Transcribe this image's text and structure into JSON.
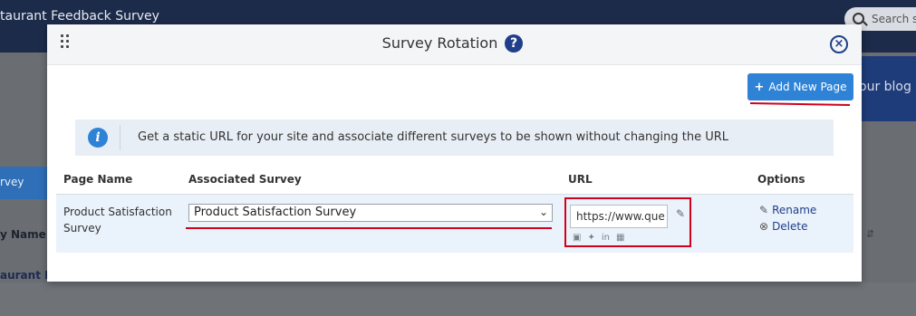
{
  "background": {
    "app_title": "taurant Feedback Survey",
    "search_placeholder": "Search s",
    "right_blurb": "our blog",
    "left_tab": "rvey",
    "left_column_header": "y Name",
    "left_row_link": "aurant Feed"
  },
  "modal": {
    "title": "Survey Rotation",
    "help_icon": "?",
    "close_icon": "×",
    "add_button": {
      "icon": "+",
      "label": "Add New Page"
    },
    "info": {
      "icon": "i",
      "text": "Get a static URL for your site and associate different surveys to be shown without changing the URL"
    },
    "table": {
      "headers": {
        "page_name": "Page Name",
        "associated_survey": "Associated Survey",
        "url": "URL",
        "options": "Options"
      },
      "row": {
        "page_name": "Product Satisfaction Survey",
        "survey_selected": "Product Satisfaction Survey",
        "url_value": "https://www.que",
        "social_icons": [
          "facebook-icon",
          "twitter-icon",
          "linkedin-icon",
          "qr-code-icon"
        ],
        "options": {
          "rename": "Rename",
          "delete": "Delete"
        }
      }
    }
  },
  "colors": {
    "header_navy": "#1d2b4a",
    "primary_blue": "#2f83d6",
    "icon_navy": "#1f3f8a",
    "highlight_red": "#d0021b",
    "row_bg": "#eaf2fb"
  }
}
